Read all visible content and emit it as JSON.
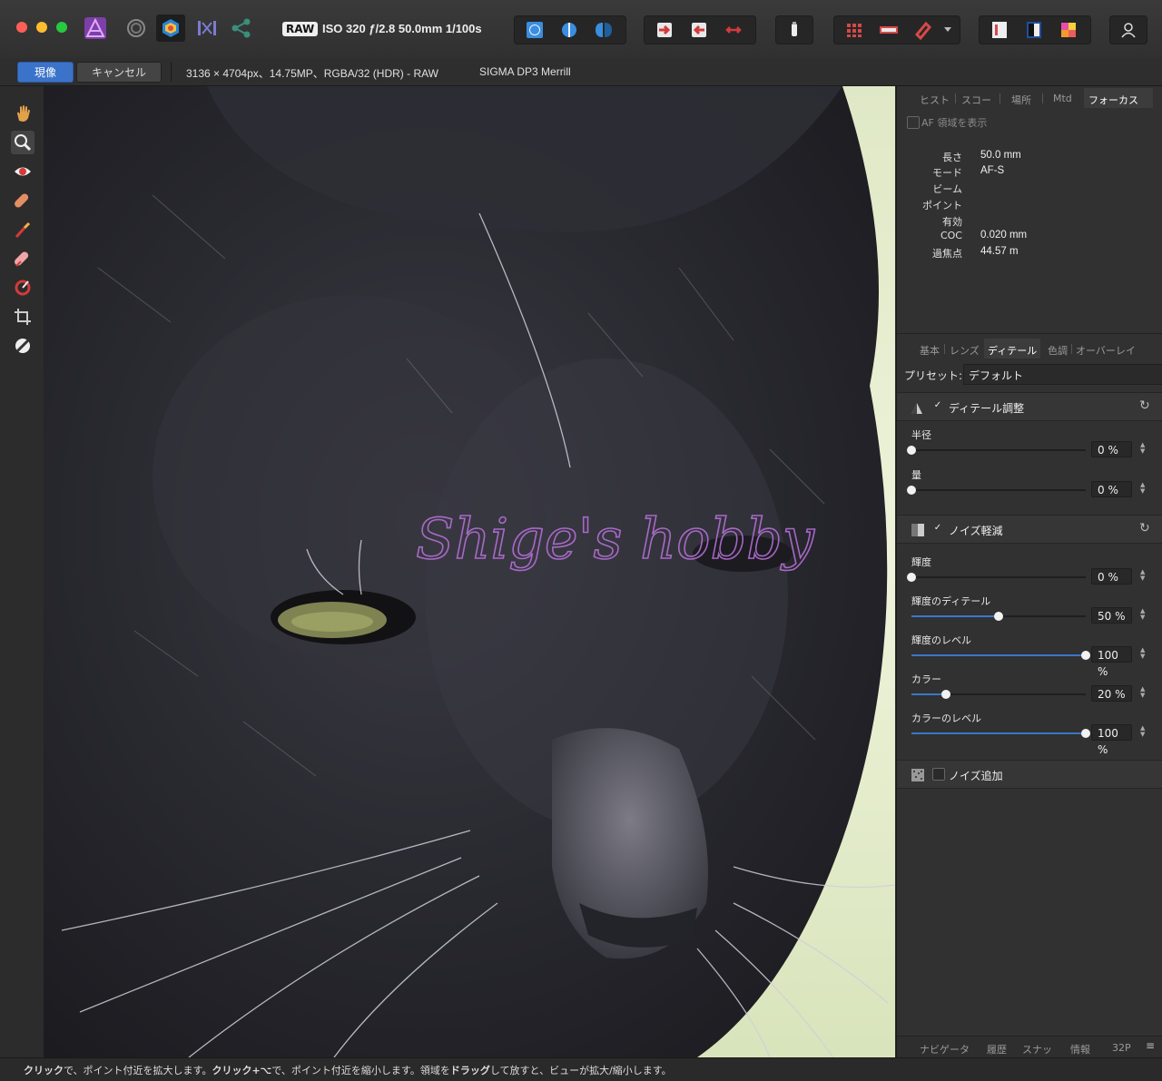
{
  "window": {
    "traffic_colors": [
      "#ff5f57",
      "#febc2e",
      "#28c840"
    ]
  },
  "toolbar": {
    "raw_badge": "RAW",
    "exif": "ISO 320 ƒ/2.8 50.0mm 1/100s",
    "icons": [
      "persona-photo-icon",
      "persona-liquify-icon",
      "persona-develop-icon",
      "persona-tone-mapping-icon",
      "persona-export-icon",
      "view-single-icon",
      "view-split-icon",
      "view-mirror-icon",
      "rotate-left-icon",
      "rotate-right-icon",
      "flip-icon",
      "clipping-icon",
      "histogram-toggle-icon",
      "profile-icon",
      "overlay-icon",
      "white-balance-icon",
      "color-picker-icon",
      "assistant-icon"
    ]
  },
  "context": {
    "develop_label": "現像",
    "cancel_label": "キャンセル",
    "image_info": "3136 × 4704px、14.75MP、RGBA/32 (HDR) - RAW",
    "camera": "SIGMA DP3 Merrill"
  },
  "canvas": {
    "watermark": "Shige's hobby"
  },
  "panel_top": {
    "tabs": [
      "ヒスト",
      "スコー",
      "場所",
      "Mtd",
      "フォーカス"
    ],
    "active_tab": "フォーカス",
    "show_af_label": "AF 領域を表示",
    "rows": [
      {
        "label": "長さ",
        "value": "50.0 mm"
      },
      {
        "label": "モード",
        "value": "AF-S"
      },
      {
        "label": "ビーム",
        "value": ""
      },
      {
        "label": "ポイント",
        "value": ""
      },
      {
        "label": "有効",
        "value": ""
      },
      {
        "label": "COC",
        "value": "0.020 mm"
      },
      {
        "label": "過焦点",
        "value": "44.57 m"
      }
    ]
  },
  "panel_mid": {
    "tabs": [
      "基本",
      "レンズ",
      "ディテール",
      "色調",
      "オーバーレイ"
    ],
    "active_tab": "ディテール",
    "preset_label": "プリセット:",
    "preset_value": "デフォルト",
    "detail_section": {
      "title": "ディテール調整",
      "checked": true,
      "sliders": [
        {
          "label": "半径",
          "value": "0 %",
          "fraction": 0.0
        },
        {
          "label": "量",
          "value": "0 %",
          "fraction": 0.0
        }
      ]
    },
    "noise_section": {
      "title": "ノイズ軽減",
      "checked": true,
      "sliders": [
        {
          "label": "輝度",
          "value": "0 %",
          "fraction": 0.0
        },
        {
          "label": "輝度のディテール",
          "value": "50 %",
          "fraction": 0.5
        },
        {
          "label": "輝度のレベル",
          "value": "100 %",
          "fraction": 1.0
        },
        {
          "label": "カラー",
          "value": "20 %",
          "fraction": 0.2
        },
        {
          "label": "カラーのレベル",
          "value": "100 %",
          "fraction": 1.0
        }
      ]
    },
    "add_noise": {
      "title": "ノイズ追加",
      "checked": false
    }
  },
  "panel_bottom": {
    "tabs": [
      "ナビゲータ",
      "履歴",
      "スナッ",
      "情報",
      "32P"
    ]
  },
  "status": {
    "text_parts": [
      {
        "t": "クリック",
        "b": true
      },
      {
        "t": "で、ポイント付近を拡大します。",
        "b": false
      },
      {
        "t": "クリック+⌥",
        "b": true
      },
      {
        "t": "で、ポイント付近を縮小します。領域を",
        "b": false
      },
      {
        "t": "ドラッグ",
        "b": true
      },
      {
        "t": "して放すと、ビューが拡大/縮小します。",
        "b": false
      }
    ]
  },
  "colors": {
    "accent": "#3a73c9",
    "watermark": "#b56fd6"
  }
}
